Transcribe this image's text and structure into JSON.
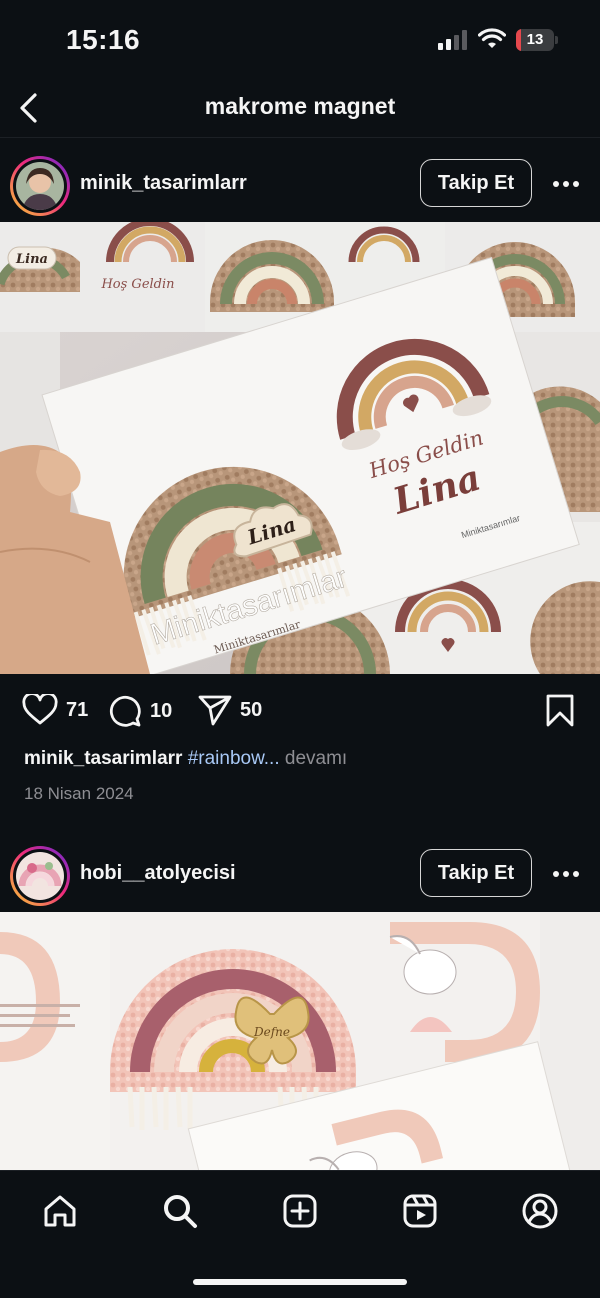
{
  "status": {
    "time": "15:16",
    "battery": "13",
    "battery_level": 0.13
  },
  "nav": {
    "title": "makrome magnet"
  },
  "posts": [
    {
      "username": "minik_tasarimlarr",
      "follow_label": "Takip Et",
      "photo": {
        "small_card_name": "Lina",
        "small_card_greeting": "Hoş Geldin",
        "card_greeting": "Hoş Geldin",
        "card_name": "Lina",
        "magnet_name": "Lina",
        "watermark": "Miniktasarımlar",
        "card_brand": "Miniktasarımlar"
      },
      "likes": "71",
      "comments": "10",
      "shares": "50",
      "caption_user": "minik_tasarimlarr",
      "caption_tag": "#rainbow...",
      "caption_more": "devamı",
      "date": "18 Nisan 2024"
    },
    {
      "username": "hobi__atolyecisi",
      "follow_label": "Takip Et",
      "photo": {
        "magnet_name": "Defne"
      }
    }
  ],
  "tabs": [
    "home",
    "search",
    "create",
    "reels",
    "profile"
  ],
  "colors": {
    "background": "#0c1014",
    "text": "#f5f5f5",
    "muted": "#8e8e93",
    "hashtag": "#a8c8f5",
    "battery": "#e5484d"
  }
}
